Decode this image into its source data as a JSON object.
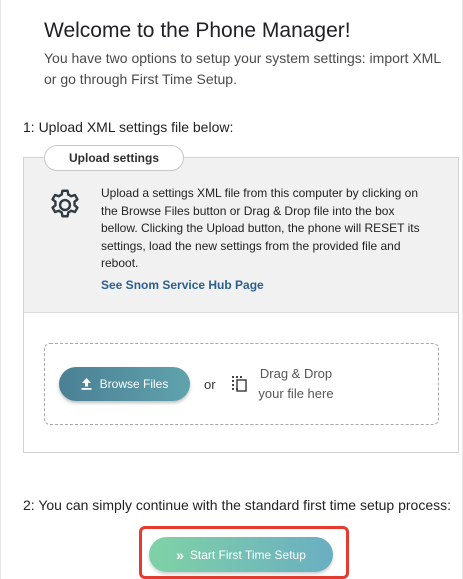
{
  "header": {
    "title": "Welcome to the Phone Manager!",
    "subtitle": "You have two options to setup your system settings: import XML or go through First Time Setup."
  },
  "step1": {
    "label": "1: Upload XML settings file below:",
    "tab_label": "Upload settings",
    "icon": "gear-icon",
    "description": "Upload a settings XML file from this computer by clicking on the Browse Files button or Drag & Drop file into the box bellow. Clicking the Upload button, the phone will RESET its settings, load the new settings from the provided file and reboot.",
    "link_text": "See Snom Service Hub Page",
    "browse_label": "Browse Files",
    "or_text": "or",
    "drop_line1": "Drag & Drop",
    "drop_line2": "your file here"
  },
  "step2": {
    "label": "2: You can simply continue with the standard first time setup process:",
    "button_label": "Start First Time Setup"
  },
  "colors": {
    "link": "#2b5f8e",
    "browse_gradient": [
      "#4b7f95",
      "#5fa3ac"
    ],
    "start_gradient": [
      "#7fd2a6",
      "#6aaec2"
    ],
    "highlight": "#e53b2f"
  }
}
